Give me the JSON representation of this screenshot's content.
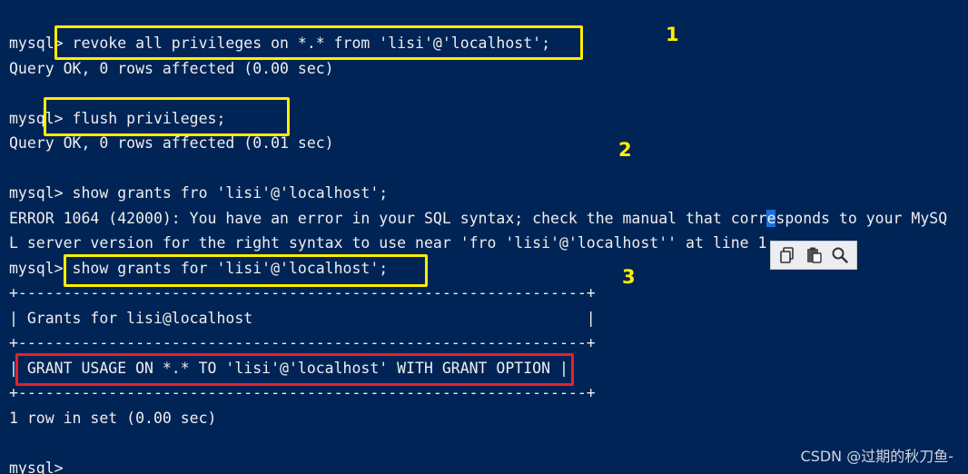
{
  "terminal": {
    "lines": [
      {
        "text": "mysql> revoke all privileges on *.* from 'lisi'@'localhost';"
      },
      {
        "text": "Query OK, 0 rows affected (0.00 sec)"
      },
      {
        "text": "mysql> flush privileges;"
      },
      {
        "text": "Query OK, 0 rows affected (0.01 sec)"
      },
      {
        "text": "mysql> show grants fro 'lisi'@'localhost';"
      },
      {
        "text_before": "ERROR 1064 (42000): You have an error in your SQL syntax; check the manual that corr",
        "text_cursor": "e",
        "text_after": "sponds to your MySQ"
      },
      {
        "text": "L server version for the right syntax to use near 'fro 'lisi'@'localhost'' at line 1"
      },
      {
        "text": "mysql> show grants for 'lisi'@'localhost';"
      },
      {
        "text": "+---------------------------------------------------------------+"
      },
      {
        "text": "| Grants for lisi@localhost                                     |"
      },
      {
        "text": "+---------------------------------------------------------------+"
      },
      {
        "text": "| GRANT USAGE ON *.* TO 'lisi'@'localhost' WITH GRANT OPTION |"
      },
      {
        "text": "+---------------------------------------------------------------+"
      },
      {
        "text": "1 row in set (0.00 sec)"
      },
      {
        "text": "mysql>"
      }
    ]
  },
  "annotations": {
    "step1": "1",
    "step2": "2",
    "step3": "3",
    "highlight_color": "#ffee00",
    "result_highlight_color": "#e8202a"
  },
  "toolbar": {
    "icons": [
      "copy-icon",
      "paste-icon",
      "search-icon"
    ]
  },
  "watermark": "CSDN @过期的秋刀鱼-",
  "colors": {
    "background": "#012456",
    "text": "#eeeeee"
  }
}
